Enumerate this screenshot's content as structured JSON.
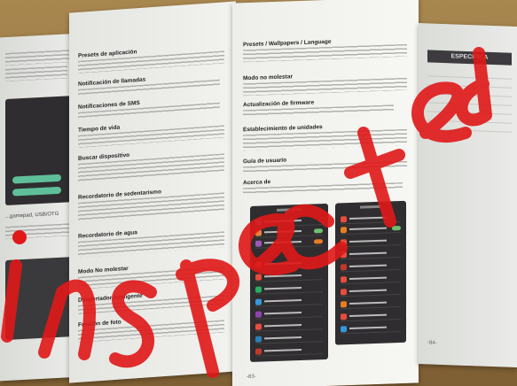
{
  "image": {
    "description_words": []
  },
  "left_panel": {
    "caption": "...gamepad, USB/OTG"
  },
  "middle_panel": {
    "sections": [
      {
        "heading": "Presets de aplicación"
      },
      {
        "heading": "Notificación de llamadas"
      },
      {
        "heading": "Notificaciones de SMS"
      },
      {
        "heading": "Tiempo de vida"
      },
      {
        "heading": "Buscar dispositivo"
      },
      {
        "heading": "Recordatorio de sedentarismo"
      },
      {
        "heading": "Recordatorio de agua"
      },
      {
        "heading": "Modo No molestar"
      },
      {
        "heading": "Despertador inteligente"
      },
      {
        "heading": "Función de foto"
      }
    ]
  },
  "right_panel": {
    "sections": [
      {
        "heading": "Presets / Wallpapers / Language"
      },
      {
        "heading": "Modo no molestar"
      },
      {
        "heading": "Actualización de firmware"
      },
      {
        "heading": "Establecimiento de unidades"
      },
      {
        "heading": "Guía de usuario"
      },
      {
        "heading": "Acerca de"
      }
    ],
    "page_number": "-83-"
  },
  "spec_panel": {
    "title": "ESPECIFICA",
    "page_number": "-84-"
  },
  "watermark": {
    "text": "Inspected",
    "color": "#e01818"
  }
}
